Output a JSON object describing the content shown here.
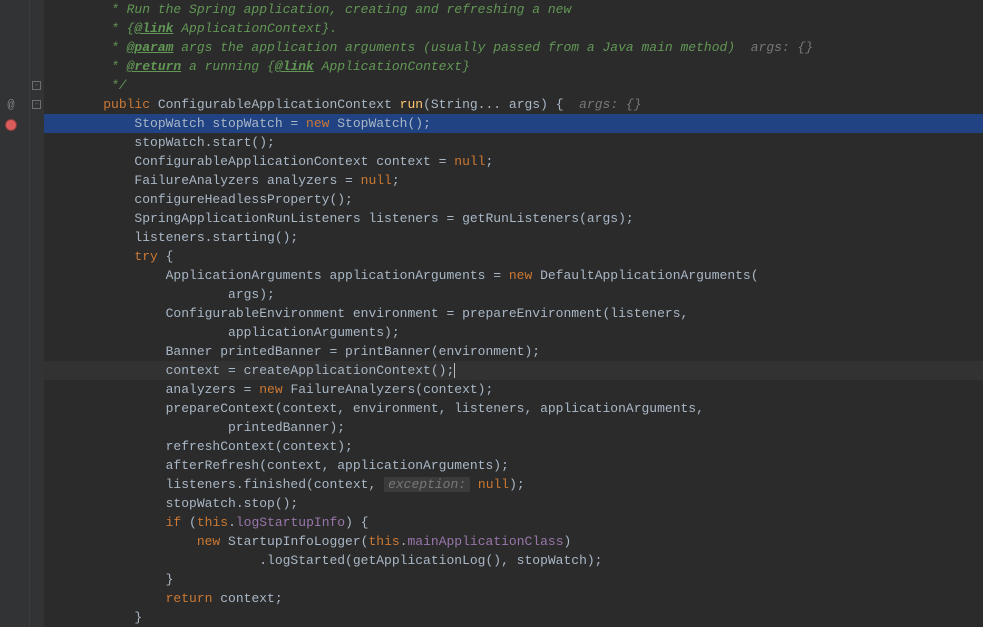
{
  "code_lines": [
    {
      "indent": 1,
      "type": "javadoc",
      "content": " * Run the Spring application, creating and refreshing a new"
    },
    {
      "indent": 1,
      "type": "javadoc",
      "content": " * {@link ApplicationContext}."
    },
    {
      "indent": 1,
      "type": "javadoc",
      "content": " * @param args the application arguments (usually passed from a Java main method)  args: {}"
    },
    {
      "indent": 1,
      "type": "javadoc",
      "content": " * @return a running {@link ApplicationContext}"
    },
    {
      "indent": 1,
      "type": "javadoc",
      "content": " */"
    },
    {
      "indent": 1,
      "type": "method-sig",
      "content": "public ConfigurableApplicationContext run(String... args) {  args: {}"
    },
    {
      "indent": 2,
      "type": "code-hl",
      "content": "StopWatch stopWatch = new StopWatch();"
    },
    {
      "indent": 2,
      "type": "code",
      "content": "stopWatch.start();"
    },
    {
      "indent": 2,
      "type": "code",
      "content": "ConfigurableApplicationContext context = null;"
    },
    {
      "indent": 2,
      "type": "code",
      "content": "FailureAnalyzers analyzers = null;"
    },
    {
      "indent": 2,
      "type": "code",
      "content": "configureHeadlessProperty();"
    },
    {
      "indent": 2,
      "type": "code",
      "content": "SpringApplicationRunListeners listeners = getRunListeners(args);"
    },
    {
      "indent": 2,
      "type": "code",
      "content": "listeners.starting();"
    },
    {
      "indent": 2,
      "type": "code",
      "content": "try {"
    },
    {
      "indent": 3,
      "type": "code",
      "content": "ApplicationArguments applicationArguments = new DefaultApplicationArguments("
    },
    {
      "indent": 5,
      "type": "code",
      "content": "args);"
    },
    {
      "indent": 3,
      "type": "code",
      "content": "ConfigurableEnvironment environment = prepareEnvironment(listeners,"
    },
    {
      "indent": 5,
      "type": "code",
      "content": "applicationArguments);"
    },
    {
      "indent": 3,
      "type": "code",
      "content": "Banner printedBanner = printBanner(environment);"
    },
    {
      "indent": 3,
      "type": "code",
      "content": "context = createApplicationContext();|"
    },
    {
      "indent": 3,
      "type": "code",
      "content": "analyzers = new FailureAnalyzers(context);"
    },
    {
      "indent": 3,
      "type": "code",
      "content": "prepareContext(context, environment, listeners, applicationArguments,"
    },
    {
      "indent": 5,
      "type": "code",
      "content": "printedBanner);"
    },
    {
      "indent": 3,
      "type": "code",
      "content": "refreshContext(context);"
    },
    {
      "indent": 3,
      "type": "code",
      "content": "afterRefresh(context, applicationArguments);"
    },
    {
      "indent": 3,
      "type": "code",
      "content": "listeners.finished(context,  exception: null);"
    },
    {
      "indent": 3,
      "type": "code",
      "content": "stopWatch.stop();"
    },
    {
      "indent": 3,
      "type": "code",
      "content": "if (this.logStartupInfo) {"
    },
    {
      "indent": 4,
      "type": "code",
      "content": "new StartupInfoLogger(this.mainApplicationClass)"
    },
    {
      "indent": 6,
      "type": "code",
      "content": ".logStarted(getApplicationLog(), stopWatch);"
    },
    {
      "indent": 3,
      "type": "code",
      "content": "}"
    },
    {
      "indent": 3,
      "type": "code",
      "content": "return context;"
    },
    {
      "indent": 2,
      "type": "code",
      "content": "}"
    }
  ],
  "gutter": {
    "override_tooltip": "Override",
    "breakpoint_tooltip": "Breakpoint"
  }
}
